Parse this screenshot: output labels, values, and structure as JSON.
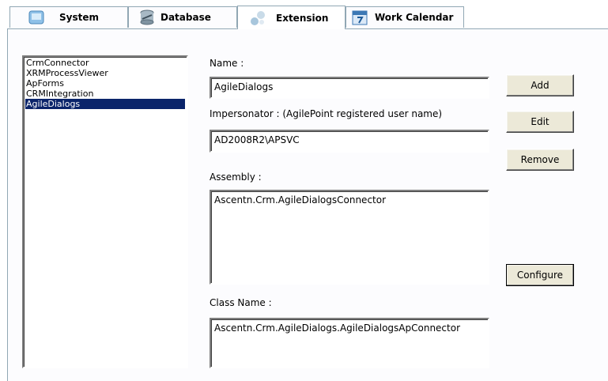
{
  "tabs": [
    {
      "label": "System",
      "icon": "system-icon",
      "active": false
    },
    {
      "label": "Database",
      "icon": "database-icon",
      "active": false
    },
    {
      "label": "Extension",
      "icon": "extension-icon",
      "active": true
    },
    {
      "label": "Work Calendar",
      "icon": "calendar-icon",
      "active": false
    }
  ],
  "extensions_list": {
    "items": [
      "CrmConnector",
      "XRMProcessViewer",
      "ApForms",
      "CRMIntegration",
      "AgileDialogs"
    ],
    "selected": "AgileDialogs"
  },
  "form": {
    "name_label": "Name :",
    "name_value": "AgileDialogs",
    "impersonator_label": "Impersonator : (AgilePoint registered user name)",
    "impersonator_value": "AD2008R2\\APSVC",
    "assembly_label": "Assembly :",
    "assembly_value": "Ascentn.Crm.AgileDialogsConnector",
    "class_label": "Class Name :",
    "class_value": "Ascentn.Crm.AgileDialogs.AgileDialogsApConnector"
  },
  "buttons": {
    "add": "Add",
    "edit": "Edit",
    "remove": "Remove",
    "configure": "Configure"
  },
  "colors": {
    "selection": "#0a246a",
    "tab_border": "#91a7b4",
    "button_face": "#ece9d8"
  }
}
